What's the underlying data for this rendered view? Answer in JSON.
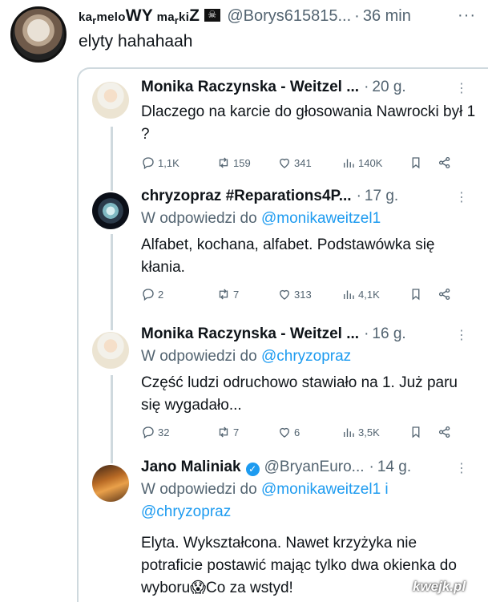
{
  "outer": {
    "author_name_small_1": "ka",
    "author_name_small_2": "r",
    "author_name_small_3": "melo",
    "author_name_big_1": "WY",
    "author_name_small_4": " ma",
    "author_name_small_5": "r",
    "author_name_small_6": "ki",
    "author_name_big_2": "Z",
    "handle": "@Borys615815...",
    "dot": "·",
    "time": "36 min",
    "more": "···",
    "text": "elyty hahahaah"
  },
  "replies": [
    {
      "name": "Monika Raczynska - Weitzel ...",
      "time": "20 g.",
      "reply_to_prefix": "",
      "text": "Dlaczego na karcie do głosowania Nawrocki był 1 ?",
      "replies": "1,1K",
      "retweets": "159",
      "likes": "341",
      "views": "140K"
    },
    {
      "name": "chryzopraz #Reparations4P...",
      "time": "17 g.",
      "reply_to_prefix": "W odpowiedzi do ",
      "reply_to_mention": "@monikaweitzel1",
      "text": "Alfabet, kochana, alfabet. Podstawówka się kłania.",
      "replies": "2",
      "retweets": "7",
      "likes": "313",
      "views": "4,1K"
    },
    {
      "name": "Monika Raczynska - Weitzel ...",
      "time": "16 g.",
      "reply_to_prefix": "W odpowiedzi do ",
      "reply_to_mention": "@chryzopraz",
      "text": "Część ludzi odruchowo stawiało na 1. Już paru się wygadało...",
      "replies": "32",
      "retweets": "7",
      "likes": "6",
      "views": "3,5K"
    },
    {
      "name": "Jano Maliniak",
      "handle": "@BryanEuro...",
      "time": "14 g.",
      "reply_to_prefix": "W odpowiedzi do ",
      "reply_to_mention": "@monikaweitzel1 i",
      "reply_to_mention_2": "@chryzopraz",
      "text": "Elyta. Wykształcona. Nawet krzyżyka nie potraficie postawić mając tylko dwa okienka do wyboru😱Co za wstyd!"
    }
  ],
  "dot": "·",
  "more": "⋮",
  "watermark": "kwejk.pl",
  "colors": {
    "accent": "#1d9bf0",
    "muted": "#536471",
    "border": "#cfd9de"
  }
}
